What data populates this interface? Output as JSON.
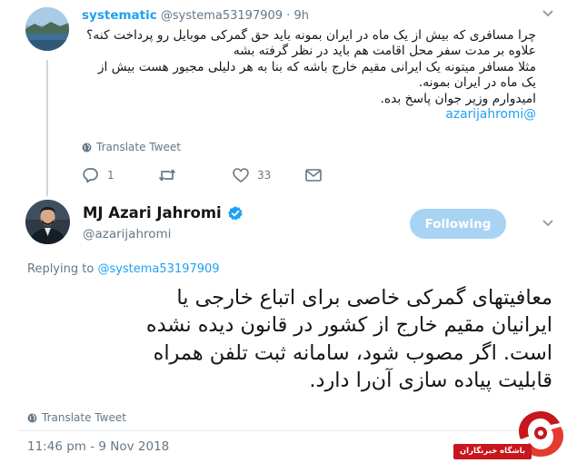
{
  "parent_tweet": {
    "author_name": "systematic",
    "author_handle": "@systema53197909",
    "separator": "·",
    "time": "9h",
    "body_lines": [
      "چرا مسافری که بیش از یک ماه در ایران بمونه باید حق گمرکی موبایل رو پرداخت کنه؟",
      "علاوه بر مدت سفر محل اقامت هم باید در نظر گرفته بشه",
      "مثلا مسافر میتونه یک ایرانی مقیم خارج باشه که بنا به هر دلیلی مجبور هست بیش از",
      "یک ماه در ایران بمونه.",
      "امیدوارم وزیر جوان پاسخ بده.",
      "@azarijahromi"
    ],
    "translate_label": "Translate Tweet",
    "reply_count": "1",
    "retweet_count": "",
    "like_count": "33"
  },
  "main_tweet": {
    "author_name": "MJ Azari Jahromi",
    "author_handle": "@azarijahromi",
    "follow_button": "Following",
    "replying_prefix": "Replying to",
    "replying_handle": "@systema53197909",
    "body_lines": [
      "معافیتهای گمرکی خاصی برای اتباع خارجی یا",
      "ایرانیان مقیم خارج از کشور در قانون دیده نشده",
      "است. اگر مصوب شود، سامانه ثبت تلفن همراه",
      "قابلیت پیاده سازی آن‌را دارد."
    ],
    "translate_label": "Translate Tweet",
    "timestamp": "11:46 pm - 9 Nov 2018"
  },
  "watermark": {
    "label": "باشگاه خبرنگاران"
  },
  "colors": {
    "link_blue": "#1da1f2",
    "muted_gray": "#657786",
    "follow_button_bg": "#a8d3f3",
    "verified_blue": "#1da1f2",
    "watermark_red": "#c8161d"
  },
  "icons": {
    "parent_avatar": "landscape-avatar",
    "main_avatar": "profile-photo-avatar",
    "verified": "verified-badge-icon",
    "globe": "globe-icon",
    "reply": "reply-icon",
    "retweet": "retweet-icon",
    "like": "heart-icon",
    "more": "more-options-icon",
    "watermark_logo": "yjc-logo"
  }
}
